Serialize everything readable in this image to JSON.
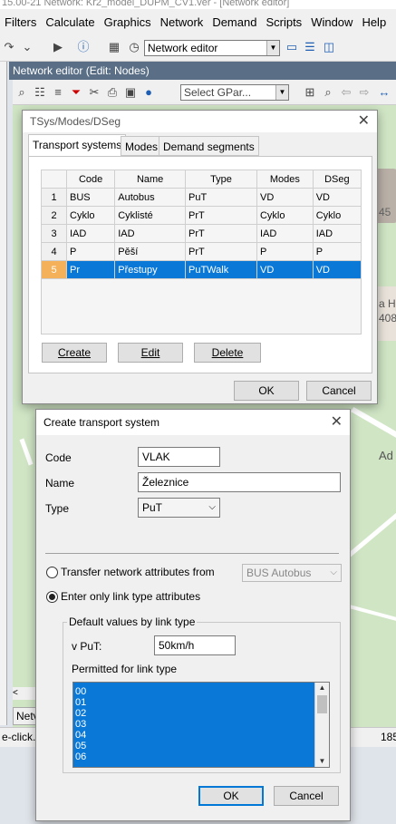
{
  "app": {
    "title": "15.00-21   Network: Kr2_model_DUPM_CV1.ver - [Network editor]",
    "menu": [
      "Filters",
      "Calculate",
      "Graphics",
      "Network",
      "Demand",
      "Scripts",
      "Window",
      "Help"
    ],
    "toolbar_combo": "Network editor",
    "subwindow_title": "Network editor (Edit: Nodes)",
    "gpar_combo": "Select GPar...",
    "status_text": "e-click.",
    "status_right": "185",
    "bottom_tab": "Netv",
    "map_labels": [
      "45",
      "a H",
      "408",
      "Ad"
    ]
  },
  "tsys_dialog": {
    "title": "TSys/Modes/DSeg",
    "tabs": [
      "Transport systems",
      "Modes",
      "Demand segments"
    ],
    "columns": [
      "Code",
      "Name",
      "Type",
      "Modes",
      "DSeg"
    ],
    "rows": [
      {
        "n": "1",
        "code": "BUS",
        "name": "Autobus",
        "type": "PuT",
        "modes": "VD",
        "dseg": "VD"
      },
      {
        "n": "2",
        "code": "Cyklo",
        "name": "Cyklisté",
        "type": "PrT",
        "modes": "Cyklo",
        "dseg": "Cyklo"
      },
      {
        "n": "3",
        "code": "IAD",
        "name": "IAD",
        "type": "PrT",
        "modes": "IAD",
        "dseg": "IAD"
      },
      {
        "n": "4",
        "code": "P",
        "name": "Pěší",
        "type": "PrT",
        "modes": "P",
        "dseg": "P"
      },
      {
        "n": "5",
        "code": "Pr",
        "name": "Přestupy",
        "type": "PuTWalk",
        "modes": "VD",
        "dseg": "VD"
      }
    ],
    "selected_row": 5,
    "create_label": "Create",
    "edit_label": "Edit",
    "delete_label": "Delete",
    "ok_label": "OK",
    "cancel_label": "Cancel"
  },
  "create_dialog": {
    "title": "Create transport system",
    "code_label": "Code",
    "code_value": "VLAK",
    "name_label": "Name",
    "name_value": "Železnice",
    "type_label": "Type",
    "type_value": "PuT",
    "transfer_label": "Transfer network attributes from",
    "transfer_combo": "BUS Autobus",
    "enter_only_label": "Enter only link type attributes",
    "group_label": "Default values by link type",
    "vput_label": "v PuT:",
    "vput_value": "50km/h",
    "permitted_label": "Permitted for link type",
    "link_types": [
      "00",
      "01",
      "02",
      "03",
      "04",
      "05",
      "06"
    ],
    "ok_label": "OK",
    "cancel_label": "Cancel"
  }
}
